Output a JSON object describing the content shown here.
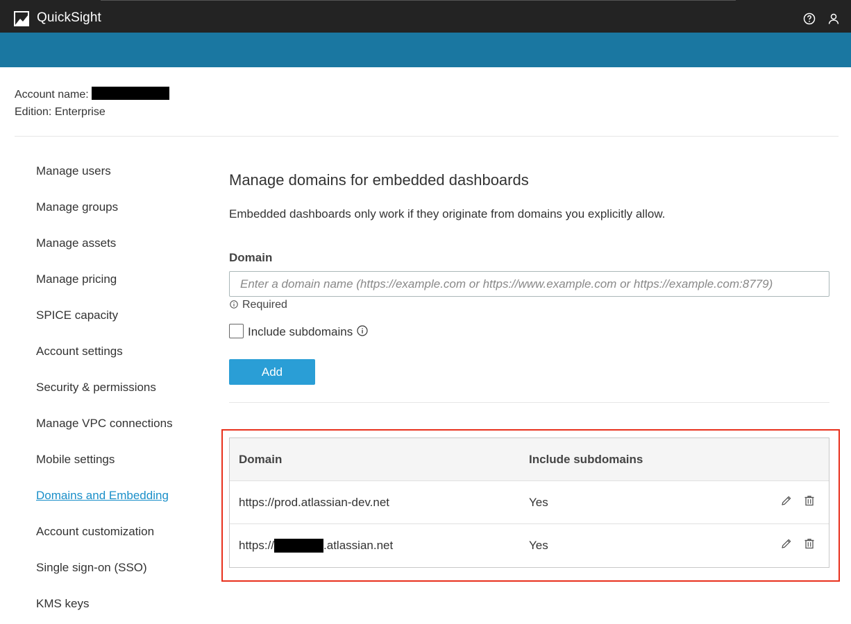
{
  "app": {
    "title": "QuickSight"
  },
  "account": {
    "name_label": "Account name:",
    "edition_label": "Edition: Enterprise"
  },
  "sidebar": {
    "items": [
      {
        "label": "Manage users",
        "active": false
      },
      {
        "label": "Manage groups",
        "active": false
      },
      {
        "label": "Manage assets",
        "active": false
      },
      {
        "label": "Manage pricing",
        "active": false
      },
      {
        "label": "SPICE capacity",
        "active": false
      },
      {
        "label": "Account settings",
        "active": false
      },
      {
        "label": "Security & permissions",
        "active": false
      },
      {
        "label": "Manage VPC connections",
        "active": false
      },
      {
        "label": "Mobile settings",
        "active": false
      },
      {
        "label": "Domains and Embedding",
        "active": true
      },
      {
        "label": "Account customization",
        "active": false
      },
      {
        "label": "Single sign-on (SSO)",
        "active": false
      },
      {
        "label": "KMS keys",
        "active": false
      }
    ]
  },
  "main": {
    "title": "Manage domains for embedded dashboards",
    "description": "Embedded dashboards only work if they originate from domains you explicitly allow.",
    "domain_label": "Domain",
    "domain_value": "",
    "domain_placeholder": "Enter a domain name (https://example.com or https://www.example.com or https://example.com:8779)",
    "required_text": "Required",
    "include_subdomains_label": "Include subdomains",
    "include_subdomains_checked": false,
    "add_label": "Add"
  },
  "table": {
    "columns": [
      "Domain",
      "Include subdomains"
    ],
    "rows": [
      {
        "domain": "https://prod.atlassian-dev.net",
        "include_subdomains": "Yes"
      },
      {
        "domain_prefix": "https://",
        "domain_suffix": ".atlassian.net",
        "include_subdomains": "Yes"
      }
    ]
  },
  "colors": {
    "topbar": "#232323",
    "banner": "#1a77a1",
    "accent_link": "#1a8fc9",
    "button": "#2a9ed6",
    "highlight_border": "#e8301c"
  },
  "icons": {
    "logo": "quicksight-logo-icon",
    "help": "help-circle-icon",
    "user": "user-icon",
    "info": "info-circle-icon",
    "edit": "pencil-icon",
    "delete": "trash-icon"
  }
}
